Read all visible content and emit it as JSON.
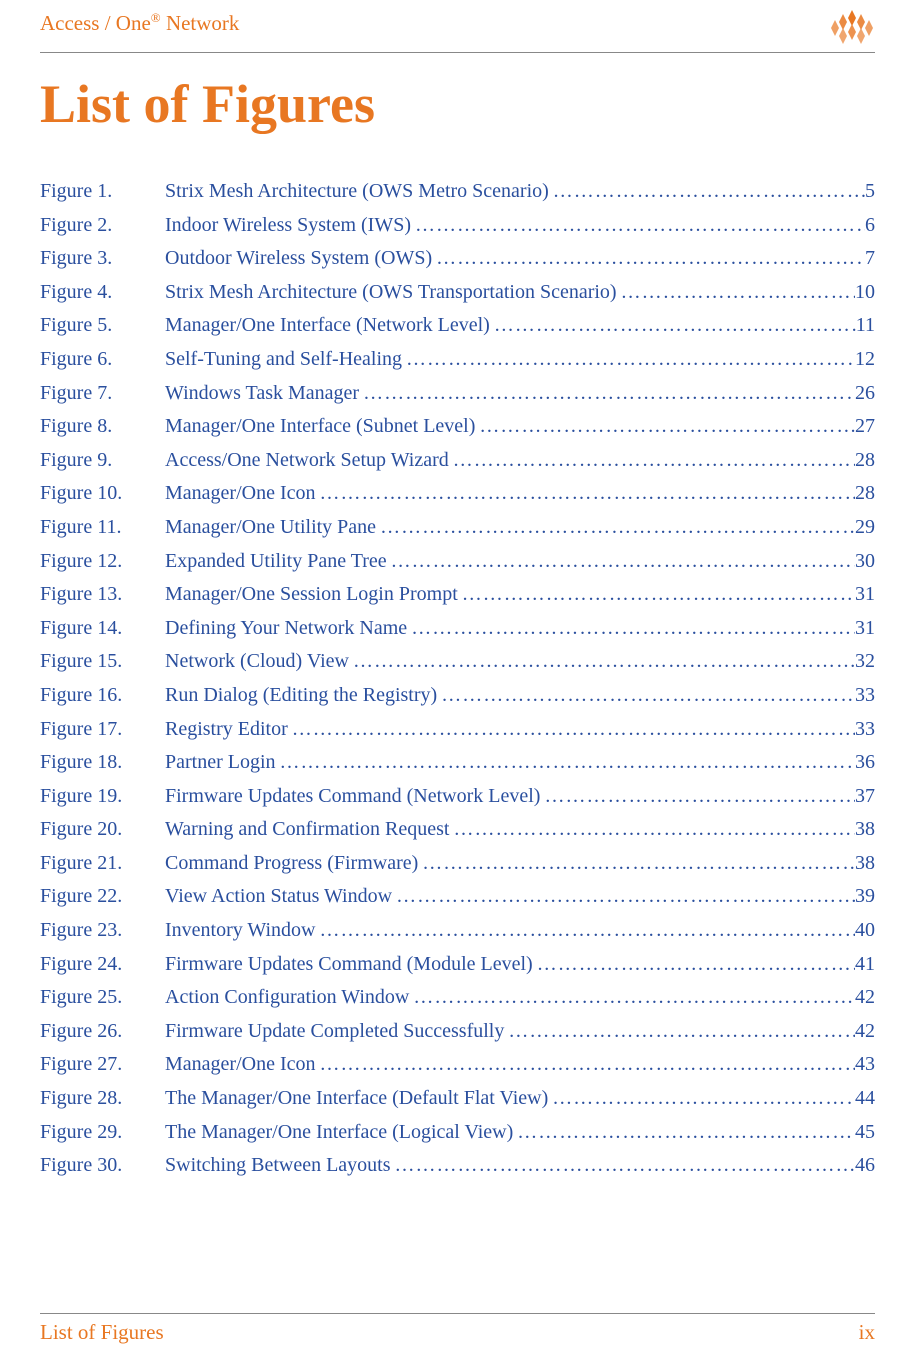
{
  "header": {
    "product_brand": "Access / One",
    "reg_mark": "®",
    "suffix": " Network"
  },
  "title": "List of Figures",
  "entries": [
    {
      "label": "Figure 1.",
      "text": "Strix Mesh Architecture (OWS Metro Scenario)",
      "page": "5"
    },
    {
      "label": "Figure 2.",
      "text": "Indoor Wireless System (IWS)",
      "page": "6"
    },
    {
      "label": "Figure 3.",
      "text": "Outdoor Wireless System (OWS)",
      "page": "7"
    },
    {
      "label": "Figure 4.",
      "text": "Strix Mesh Architecture (OWS Transportation Scenario)",
      "page": "10"
    },
    {
      "label": "Figure 5.",
      "text": "Manager/One Interface (Network Level)",
      "page": "11"
    },
    {
      "label": "Figure 6.",
      "text": "Self-Tuning and Self-Healing",
      "page": "12"
    },
    {
      "label": "Figure 7.",
      "text": "Windows Task Manager",
      "page": "26"
    },
    {
      "label": "Figure 8.",
      "text": "Manager/One Interface (Subnet Level)",
      "page": "27"
    },
    {
      "label": "Figure 9.",
      "text": "Access/One Network Setup Wizard",
      "page": "28"
    },
    {
      "label": "Figure 10.",
      "text": "Manager/One Icon",
      "page": "28"
    },
    {
      "label": "Figure 11.",
      "text": "Manager/One Utility Pane",
      "page": "29"
    },
    {
      "label": "Figure 12.",
      "text": "Expanded Utility Pane Tree",
      "page": "30"
    },
    {
      "label": "Figure 13.",
      "text": "Manager/One Session Login Prompt",
      "page": "31"
    },
    {
      "label": "Figure 14.",
      "text": "Defining Your Network Name",
      "page": "31"
    },
    {
      "label": "Figure 15.",
      "text": "Network (Cloud) View",
      "page": "32"
    },
    {
      "label": "Figure 16.",
      "text": "Run Dialog (Editing the Registry)",
      "page": "33"
    },
    {
      "label": "Figure 17.",
      "text": "Registry Editor",
      "page": "33"
    },
    {
      "label": "Figure 18.",
      "text": "Partner Login",
      "page": "36"
    },
    {
      "label": "Figure 19.",
      "text": "Firmware Updates Command (Network Level)",
      "page": "37"
    },
    {
      "label": "Figure 20.",
      "text": "Warning and Confirmation Request",
      "page": "38"
    },
    {
      "label": "Figure 21.",
      "text": "Command Progress (Firmware)",
      "page": "38"
    },
    {
      "label": "Figure 22.",
      "text": "View Action Status Window",
      "page": "39"
    },
    {
      "label": "Figure 23.",
      "text": "Inventory Window",
      "page": "40"
    },
    {
      "label": "Figure 24.",
      "text": "Firmware Updates Command (Module Level)",
      "page": "41"
    },
    {
      "label": "Figure 25.",
      "text": "Action Configuration Window",
      "page": "42"
    },
    {
      "label": "Figure 26.",
      "text": "Firmware Update Completed Successfully",
      "page": "42"
    },
    {
      "label": "Figure 27.",
      "text": "Manager/One Icon",
      "page": "43"
    },
    {
      "label": "Figure 28.",
      "text": "The Manager/One Interface (Default Flat View)",
      "page": "44"
    },
    {
      "label": "Figure 29.",
      "text": "The Manager/One Interface (Logical View)",
      "page": "45"
    },
    {
      "label": "Figure 30.",
      "text": "Switching Between Layouts",
      "page": "46"
    }
  ],
  "footer": {
    "left": "List of Figures",
    "right": "ix"
  }
}
